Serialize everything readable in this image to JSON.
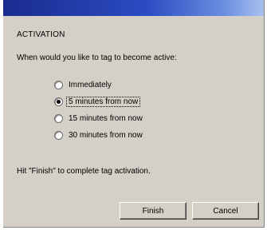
{
  "dialog": {
    "heading": "ACTIVATION",
    "prompt": "When would you like to tag to become active:",
    "options": [
      {
        "label": "Immediately",
        "checked": false
      },
      {
        "label": "5 minutes from now",
        "checked": true
      },
      {
        "label": "15 minutes from now",
        "checked": false
      },
      {
        "label": "30 minutes from now",
        "checked": false
      }
    ],
    "hint": "Hit \"Finish\" to complete tag activation.",
    "buttons": {
      "finish": "Finish",
      "cancel": "Cancel"
    }
  },
  "colors": {
    "face": "#d4d0c8",
    "title_start": "#1a2c8f",
    "title_end": "#a9c0ef"
  }
}
